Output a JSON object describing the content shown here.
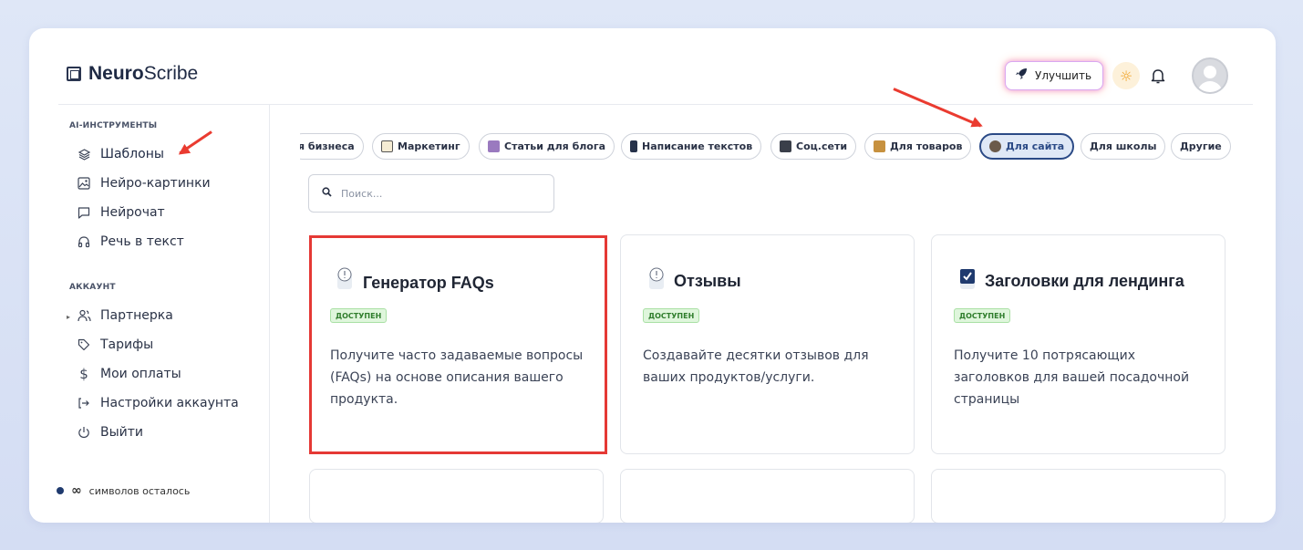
{
  "app": {
    "logo_bold": "Neuro",
    "logo_rest": "Scribe"
  },
  "header": {
    "upgrade_label": "Улучшить"
  },
  "sidebar": {
    "section_tools": "AI-ИНСТРУМЕНТЫ",
    "tools": [
      {
        "label": "Шаблоны",
        "icon": "layers-icon"
      },
      {
        "label": "Нейро-картинки",
        "icon": "image-icon"
      },
      {
        "label": "Нейрочат",
        "icon": "chat-icon"
      },
      {
        "label": "Речь в текст",
        "icon": "headphones-icon"
      }
    ],
    "section_account": "АККАУНТ",
    "account": [
      {
        "label": "Партнерка",
        "icon": "users-icon"
      },
      {
        "label": "Тарифы",
        "icon": "tag-icon"
      },
      {
        "label": "Мои оплаты",
        "icon": "dollar-icon"
      },
      {
        "label": "Настройки аккаунта",
        "icon": "logout-arrow-icon"
      },
      {
        "label": "Выйти",
        "icon": "power-icon"
      }
    ],
    "credits_symbol": "∞",
    "credits_text": "символов осталось"
  },
  "categories": [
    {
      "label": "я бизнеса"
    },
    {
      "label": "Маркетинг"
    },
    {
      "label": "Статьи для блога"
    },
    {
      "label": "Написание текстов"
    },
    {
      "label": "Соц.сети"
    },
    {
      "label": "Для товаров"
    },
    {
      "label": "Для сайта"
    },
    {
      "label": "Для школы"
    },
    {
      "label": "Другие"
    }
  ],
  "search": {
    "placeholder": "Поиск..."
  },
  "templates": [
    {
      "title": "Генератор FAQs",
      "badge": "ДОСТУПЕН",
      "desc": "Получите часто задаваемые вопросы (FAQs) на основе описания вашего продукта."
    },
    {
      "title": "Отзывы",
      "badge": "ДОСТУПЕН",
      "desc": "Создавайте десятки отзывов для ваших продуктов/услуги."
    },
    {
      "title": "Заголовки для лендинга",
      "badge": "ДОСТУПЕН",
      "desc": "Получите 10 потрясающих заголовков для вашей посадочной страницы"
    }
  ],
  "colors": {
    "accent": "#2b4a86",
    "annotation": "#ea3b30",
    "badge_bg": "#dff6dc"
  }
}
